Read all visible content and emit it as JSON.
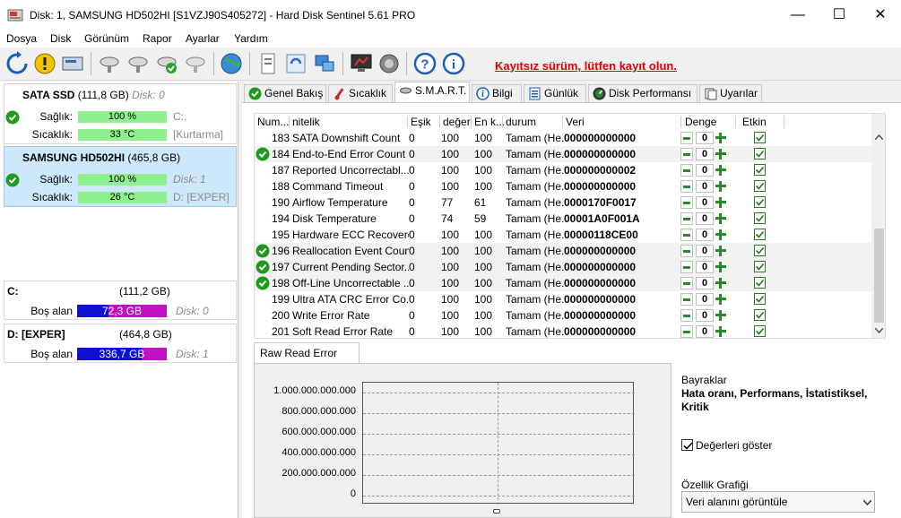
{
  "window": {
    "title": "Disk: 1, SAMSUNG HD502HI [S1VZJ90S405272]  -  Hard Disk Sentinel 5.61 PRO",
    "minimize": "—",
    "maximize": "☐",
    "close": "✕"
  },
  "menu": [
    "Dosya",
    "Disk",
    "Görünüm",
    "Rapor",
    "Ayarlar",
    "Yardım"
  ],
  "toolbar": {
    "warning": "Kayıtsız sürüm, lütfen kayıt olun."
  },
  "disks": [
    {
      "name": "SATA SSD",
      "size": "(111,8 GB)",
      "disk_no": "Disk: 0",
      "health_label": "Sağlık:",
      "health": "100 %",
      "health_pct": 100,
      "health_extra": "C:,",
      "temp_label": "Sıcaklık:",
      "temp": "33 °C",
      "temp_extra": "[Kurtarma]"
    },
    {
      "name": "SAMSUNG HD502HI",
      "size": "(465,8 GB)",
      "disk_no": "Disk: 1",
      "health_label": "Sağlık:",
      "health": "100 %",
      "health_pct": 100,
      "health_extra": "Disk: 1",
      "temp_label": "Sıcaklık:",
      "temp": "26 °C",
      "temp_extra": "D: [EXPER]"
    }
  ],
  "volumes": [
    {
      "name": "C:",
      "size": "(111,2 GB)",
      "free_label": "Boş alan",
      "free": "72,3 GB",
      "disk": "Disk: 0"
    },
    {
      "name": "D: [EXPER]",
      "size": "(464,8 GB)",
      "free_label": "Boş alan",
      "free": "336,7 GB",
      "disk": "Disk: 1"
    }
  ],
  "tabs": [
    "Genel Bakış",
    "Sıcaklık",
    "S.M.A.R.T.",
    "Bilgi",
    "Günlük",
    "Disk Performansı",
    "Uyarılar"
  ],
  "smart": {
    "headers": [
      "Num...",
      "nitelik",
      "Eşik",
      "değer",
      "En k...",
      "durum",
      "Veri",
      "Denge",
      "Etkin"
    ],
    "rows": [
      {
        "num": "183",
        "name": "SATA Downshift Count",
        "thr": "0",
        "val": "100",
        "worst": "100",
        "status": "Tamam (He...",
        "data": "000000000000",
        "ok": false,
        "bal": "0"
      },
      {
        "num": "184",
        "name": "End-to-End Error Count",
        "thr": "0",
        "val": "100",
        "worst": "100",
        "status": "Tamam (He...",
        "data": "000000000000",
        "ok": true,
        "bal": "0"
      },
      {
        "num": "187",
        "name": "Reported Uncorrectabl...",
        "thr": "0",
        "val": "100",
        "worst": "100",
        "status": "Tamam (He...",
        "data": "000000000002",
        "ok": false,
        "bal": "0"
      },
      {
        "num": "188",
        "name": "Command Timeout",
        "thr": "0",
        "val": "100",
        "worst": "100",
        "status": "Tamam (He...",
        "data": "000000000000",
        "ok": false,
        "bal": "0"
      },
      {
        "num": "190",
        "name": "Airflow Temperature",
        "thr": "0",
        "val": "77",
        "worst": "61",
        "status": "Tamam (He...",
        "data": "0000170F0017",
        "ok": false,
        "bal": "0"
      },
      {
        "num": "194",
        "name": "Disk Temperature",
        "thr": "0",
        "val": "74",
        "worst": "59",
        "status": "Tamam (He...",
        "data": "00001A0F001A",
        "ok": false,
        "bal": "0"
      },
      {
        "num": "195",
        "name": "Hardware ECC Recovered",
        "thr": "0",
        "val": "100",
        "worst": "100",
        "status": "Tamam (He...",
        "data": "00000118CE00",
        "ok": false,
        "bal": "0"
      },
      {
        "num": "196",
        "name": "Reallocation Event Count",
        "thr": "0",
        "val": "100",
        "worst": "100",
        "status": "Tamam (He...",
        "data": "000000000000",
        "ok": true,
        "bal": "0"
      },
      {
        "num": "197",
        "name": "Current Pending Sector...",
        "thr": "0",
        "val": "100",
        "worst": "100",
        "status": "Tamam (He...",
        "data": "000000000000",
        "ok": true,
        "bal": "0"
      },
      {
        "num": "198",
        "name": "Off-Line Uncorrectable ...",
        "thr": "0",
        "val": "100",
        "worst": "100",
        "status": "Tamam (He...",
        "data": "000000000000",
        "ok": true,
        "bal": "0"
      },
      {
        "num": "199",
        "name": "Ultra ATA CRC Error Co...",
        "thr": "0",
        "val": "100",
        "worst": "100",
        "status": "Tamam (He...",
        "data": "000000000000",
        "ok": false,
        "bal": "0"
      },
      {
        "num": "200",
        "name": "Write Error Rate",
        "thr": "0",
        "val": "100",
        "worst": "100",
        "status": "Tamam (He...",
        "data": "000000000000",
        "ok": false,
        "bal": "0"
      },
      {
        "num": "201",
        "name": "Soft Read Error Rate",
        "thr": "0",
        "val": "100",
        "worst": "100",
        "status": "Tamam (He...",
        "data": "000000000000",
        "ok": false,
        "bal": "0"
      }
    ]
  },
  "graph": {
    "tab": "Raw Read Error Rate",
    "y_ticks": [
      "1.000.000.000.000",
      "800.000.000.000",
      "600.000.000.000",
      "400.000.000.000",
      "200.000.000.000",
      "0"
    ]
  },
  "flags": {
    "title": "Bayraklar",
    "value": "Hata oranı, Performans, İstatistiksel, Kritik",
    "show_values": "Değerleri göster",
    "show_values_checked": true,
    "graph_label": "Özellik Grafiği",
    "graph_select": "Veri alanını görüntüle"
  }
}
